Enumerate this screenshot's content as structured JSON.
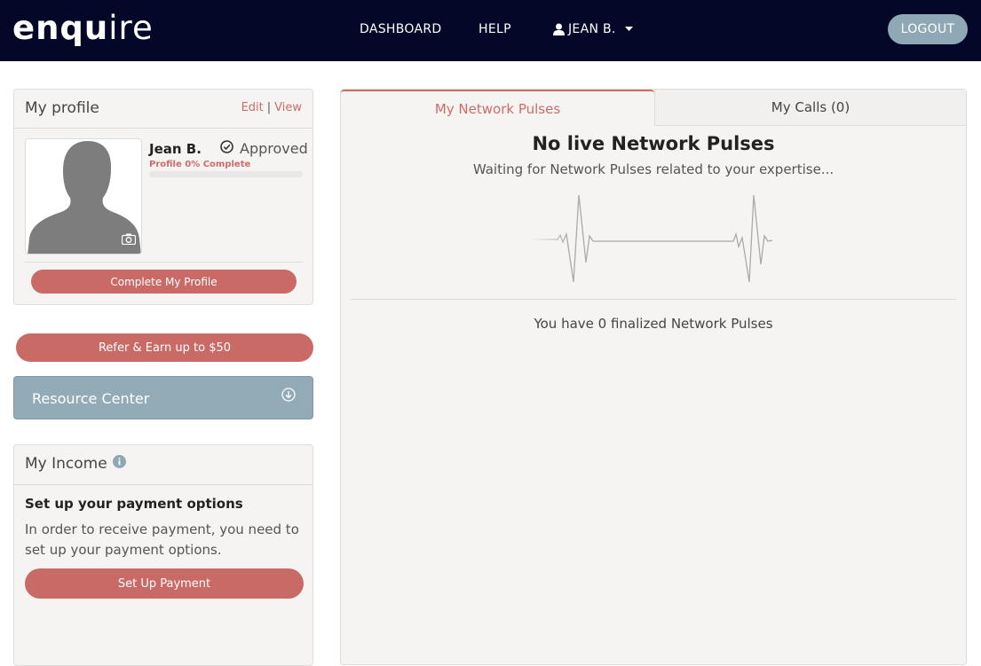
{
  "nav": {
    "logo_bold": "enqu",
    "logo_thin": "ire",
    "dashboard": "DASHBOARD",
    "help": "HELP",
    "user": "JEAN B.",
    "logout": "LOGOUT"
  },
  "profile": {
    "title": "My profile",
    "edit": "Edit",
    "separator": "|",
    "view": "View",
    "name": "Jean B.",
    "status": "Approved",
    "complete_text": "Profile 0% Complete",
    "complete_percent": 0,
    "complete_button": "Complete My Profile"
  },
  "refer": {
    "label": "Refer & Earn up to $50"
  },
  "resource": {
    "label": "Resource Center"
  },
  "income": {
    "title": "My Income",
    "heading": "Set up your payment options",
    "text": "In order to receive payment, you need to set up your payment options.",
    "button": "Set Up Payment"
  },
  "tabs": {
    "pulses": "My Network Pulses",
    "calls": "My Calls (0)"
  },
  "pulses": {
    "empty_title": "No live Network Pulses",
    "waiting": "Waiting for Network Pulses related to your expertise...",
    "finalized": "You have 0 finalized Network Pulses"
  },
  "colors": {
    "nav_bg": "#030828",
    "accent": "#c96a67",
    "resource_bg": "#93abb7",
    "logout_bg": "#8fa8b6"
  },
  "icons": {
    "user": "user-icon",
    "caret": "caret-down-icon",
    "approved": "check-circle-icon",
    "camera": "camera-icon",
    "resource": "arrow-circle-down-icon",
    "info": "info-icon",
    "pulse": "heartbeat-line"
  }
}
